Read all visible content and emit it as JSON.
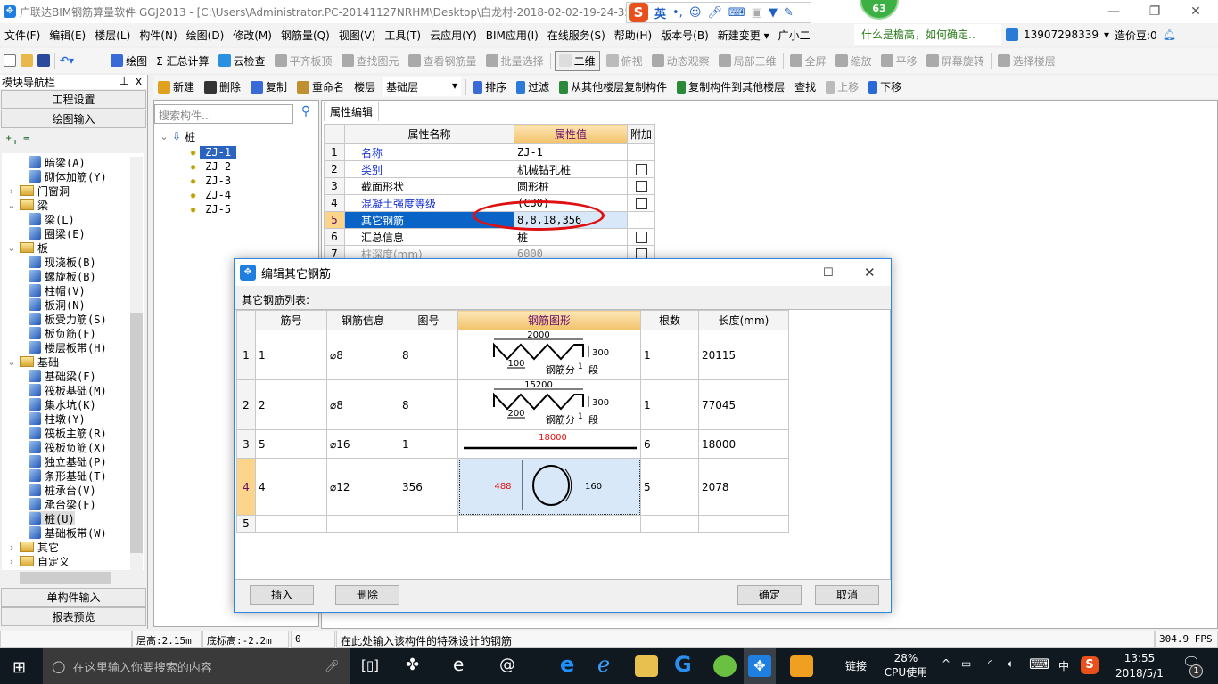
{
  "window": {
    "title": "广联达BIM钢筋算量软件 GGJ2013 - [C:\\Users\\Administrator.PC-20141127NRHM\\Desktop\\白龙村-2018-02-02-19-24-35",
    "minimize": "—",
    "restore": "❐",
    "close": "✕"
  },
  "ime": {
    "logo": "S",
    "mode": "英",
    "punct": "•,"
  },
  "notification_badge": "63",
  "menu": [
    "文件(F)",
    "编辑(E)",
    "楼层(L)",
    "构件(N)",
    "绘图(D)",
    "修改(M)",
    "钢筋量(Q)",
    "视图(V)",
    "工具(T)",
    "云应用(Y)",
    "BIM应用(I)",
    "在线服务(S)",
    "帮助(H)",
    "版本号(B)",
    "新建变更 ▾",
    "广小二"
  ],
  "tip": "什么是檐高，如何确定..",
  "account": {
    "phone": "13907298339",
    "beans": "造价豆:0"
  },
  "toolbar1": [
    "绘图",
    "Σ 汇总计算",
    "云检查",
    "平齐板顶",
    "查找图元",
    "查看钢筋量",
    "批量选择",
    "二维",
    "俯视",
    "动态观察",
    "局部三维",
    "全屏",
    "缩放",
    "平移",
    "屏幕旋转",
    "选择楼层"
  ],
  "toolbar2": {
    "items": [
      "新建",
      "删除",
      "复制",
      "重命名",
      "楼层"
    ],
    "floor": "基础层",
    "items2": [
      "排序",
      "过滤",
      "从其他楼层复制构件",
      "复制构件到其他楼层",
      "查找",
      "上移",
      "下移"
    ]
  },
  "nav": {
    "header": "模块导航栏",
    "pin": "ᵖ",
    "close": "x",
    "btn1": "工程设置",
    "btn2": "绘图输入",
    "btn3": "单构件输入",
    "btn4": "报表预览",
    "tree": [
      {
        "label": "暗梁(A)",
        "level": 2
      },
      {
        "label": "砌体加筋(Y)",
        "level": 2
      },
      {
        "label": "门窗洞",
        "level": 1,
        "folder": true,
        "exp": "›"
      },
      {
        "label": "梁",
        "level": 1,
        "folder": true,
        "exp": "⌄"
      },
      {
        "label": "梁(L)",
        "level": 2
      },
      {
        "label": "圈梁(E)",
        "level": 2
      },
      {
        "label": "板",
        "level": 1,
        "folder": true,
        "exp": "⌄"
      },
      {
        "label": "现浇板(B)",
        "level": 2
      },
      {
        "label": "螺旋板(B)",
        "level": 2
      },
      {
        "label": "柱帽(V)",
        "level": 2
      },
      {
        "label": "板洞(N)",
        "level": 2
      },
      {
        "label": "板受力筋(S)",
        "level": 2
      },
      {
        "label": "板负筋(F)",
        "level": 2
      },
      {
        "label": "楼层板带(H)",
        "level": 2
      },
      {
        "label": "基础",
        "level": 1,
        "folder": true,
        "exp": "⌄"
      },
      {
        "label": "基础梁(F)",
        "level": 2
      },
      {
        "label": "筏板基础(M)",
        "level": 2
      },
      {
        "label": "集水坑(K)",
        "level": 2
      },
      {
        "label": "柱墩(Y)",
        "level": 2
      },
      {
        "label": "筏板主筋(R)",
        "level": 2
      },
      {
        "label": "筏板负筋(X)",
        "level": 2
      },
      {
        "label": "独立基础(P)",
        "level": 2
      },
      {
        "label": "条形基础(T)",
        "level": 2
      },
      {
        "label": "桩承台(V)",
        "level": 2
      },
      {
        "label": "承台梁(F)",
        "level": 2
      },
      {
        "label": "桩(U)",
        "level": 2,
        "selected": true
      },
      {
        "label": "基础板带(W)",
        "level": 2
      },
      {
        "label": "其它",
        "level": 1,
        "folder": true,
        "exp": "›"
      },
      {
        "label": "自定义",
        "level": 1,
        "folder": true,
        "exp": "›"
      }
    ]
  },
  "components": {
    "search_placeholder": "搜索构件...",
    "root": "桩",
    "items": [
      "ZJ-1",
      "ZJ-2",
      "ZJ-3",
      "ZJ-4",
      "ZJ-5"
    ],
    "selected": "ZJ-1"
  },
  "properties": {
    "tab": "属性编辑",
    "headers": [
      "属性名称",
      "属性值",
      "附加"
    ],
    "rows": [
      {
        "n": "1",
        "name": "名称",
        "value": "ZJ-1",
        "blue": true,
        "cb": false
      },
      {
        "n": "2",
        "name": "类别",
        "value": "机械钻孔桩",
        "blue": true,
        "cb": true
      },
      {
        "n": "3",
        "name": "截面形状",
        "value": "圆形桩",
        "cb": true
      },
      {
        "n": "4",
        "name": "混凝土强度等级",
        "value": "(C30)",
        "blue": true,
        "cb": true
      },
      {
        "n": "5",
        "name": "其它钢筋",
        "value": "8,8,18,356",
        "selected": true,
        "cb": false
      },
      {
        "n": "6",
        "name": "汇总信息",
        "value": "桩",
        "cb": true
      },
      {
        "n": "7",
        "name": "桩深度(mm)",
        "value": "6000",
        "grey": true,
        "cb": true
      }
    ]
  },
  "dialog": {
    "title": "编辑其它钢筋",
    "list_label": "其它钢筋列表:",
    "headers": [
      "筋号",
      "钢筋信息",
      "图号",
      "钢筋图形",
      "根数",
      "长度(mm)"
    ],
    "rows": [
      {
        "n": "1",
        "no": "1",
        "info": "⌀8",
        "fig": "8",
        "count": "1",
        "length": "20115",
        "shape": {
          "type": "zigzag",
          "width": "2000",
          "height": "300",
          "pitch": "100",
          "note": "钢筋分",
          "seg": "1",
          "seg_unit": "段"
        }
      },
      {
        "n": "2",
        "no": "2",
        "info": "⌀8",
        "fig": "8",
        "count": "1",
        "length": "77045",
        "shape": {
          "type": "zigzag",
          "width": "15200",
          "height": "300",
          "pitch": "200",
          "note": "钢筋分",
          "seg": "1",
          "seg_unit": "段"
        }
      },
      {
        "n": "3",
        "no": "5",
        "info": "⌀16",
        "fig": "1",
        "count": "6",
        "length": "18000",
        "shape": {
          "type": "straight",
          "length": "18000"
        }
      },
      {
        "n": "4",
        "no": "4",
        "info": "⌀12",
        "fig": "356",
        "count": "5",
        "length": "2078",
        "selected": true,
        "shape": {
          "type": "hoop",
          "height": "488",
          "arc": "160"
        }
      },
      {
        "n": "5",
        "no": "",
        "info": "",
        "fig": "",
        "count": "",
        "length": ""
      }
    ],
    "buttons": {
      "insert": "插入",
      "delete": "删除",
      "ok": "确定",
      "cancel": "取消"
    }
  },
  "status": {
    "floor_height": "层高:2.15m",
    "base_elev": "底标高:-2.2m",
    "zero": "0",
    "hint": "在此处输入该构件的特殊设计的钢筋",
    "fps": "304.9 FPS"
  },
  "taskbar": {
    "search_placeholder": "在这里输入你要搜索的内容",
    "link": "链接",
    "cpu": "28%",
    "cpu_label": "CPU使用",
    "lang": "中",
    "time": "13:55",
    "date": "2018/5/1",
    "notif_count": "1"
  },
  "colors": {
    "selection": "#0a64c8",
    "accent": "#2a88e0",
    "highlight_header": "#f2c26a",
    "red": "#e01010"
  }
}
